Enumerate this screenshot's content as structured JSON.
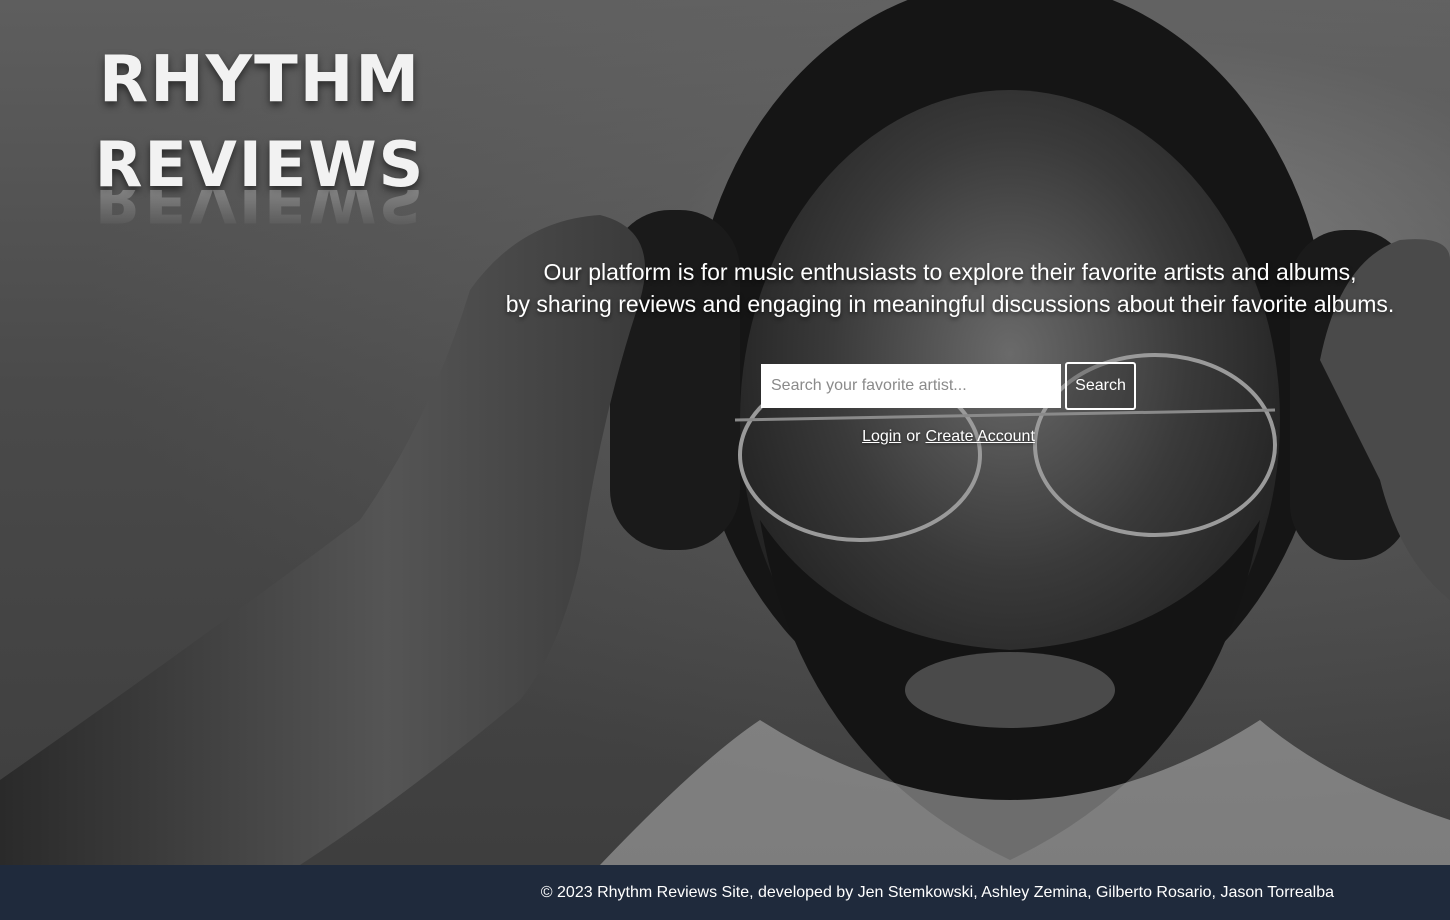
{
  "brand": {
    "logo_line1": "RHYTHM",
    "logo_line2": "REVIEWS"
  },
  "hero": {
    "tagline_line1": "Our platform is for music enthusiasts to explore their favorite artists and albums,",
    "tagline_line2": "by sharing reviews and engaging in meaningful discussions about their favorite albums."
  },
  "search": {
    "placeholder": "Search your favorite artist...",
    "value": "",
    "button_label": "Search"
  },
  "auth": {
    "login_label": "Login",
    "separator": "or",
    "create_account_label": "Create Account"
  },
  "footer": {
    "text": "© 2023 Rhythm Reviews Site, developed by Jen Stemkowski, Ashley Zemina, Gilberto Rosario, Jason Torrealba",
    "background_color": "#1f2a3c"
  }
}
